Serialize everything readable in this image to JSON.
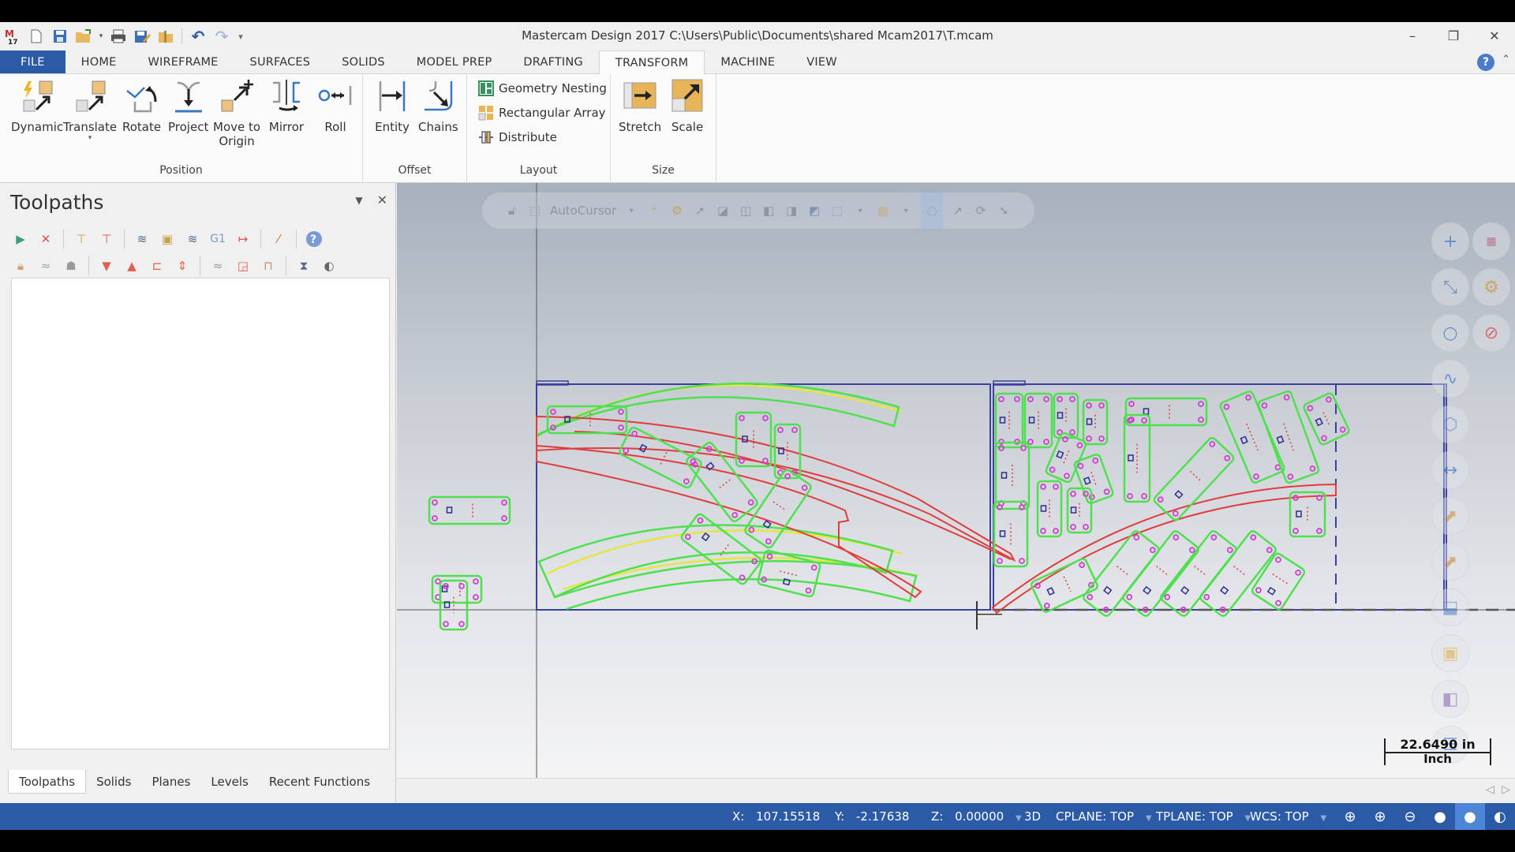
{
  "window": {
    "title": "Mastercam Design 2017  C:\\Users\\Public\\Documents\\shared Mcam2017\\T.mcam",
    "app_logo": "mastercam-17-logo",
    "minimize": "–",
    "restore": "❐",
    "close": "✕"
  },
  "quick_access": [
    {
      "name": "new-file-icon",
      "glyph": "🗋"
    },
    {
      "name": "save-icon",
      "glyph": "💾"
    },
    {
      "name": "open-folder-icon",
      "glyph": "📂"
    },
    {
      "name": "print-icon",
      "glyph": "🖶"
    },
    {
      "name": "save-as-icon",
      "glyph": "🖉"
    },
    {
      "name": "merge-icon",
      "glyph": "📁"
    },
    {
      "name": "undo-icon",
      "glyph": "↶"
    },
    {
      "name": "redo-icon",
      "glyph": "↷"
    },
    {
      "name": "customize-qat-icon",
      "glyph": "▾"
    }
  ],
  "tabs": [
    "FILE",
    "HOME",
    "WIREFRAME",
    "SURFACES",
    "SOLIDS",
    "MODEL PREP",
    "DRAFTING",
    "TRANSFORM",
    "MACHINE",
    "VIEW"
  ],
  "active_tab": "TRANSFORM",
  "ribbon": {
    "position": {
      "label": "Position",
      "buttons": [
        {
          "label": "Dynamic",
          "icon": "dynamic-transform-icon"
        },
        {
          "label": "Translate",
          "icon": "translate-icon",
          "has_dropdown": true
        },
        {
          "label": "Rotate",
          "icon": "rotate-icon"
        },
        {
          "label": "Project",
          "icon": "project-icon"
        },
        {
          "label": "Move to Origin",
          "line1": "Move to",
          "line2": "Origin",
          "icon": "move-to-origin-icon"
        },
        {
          "label": "Mirror",
          "icon": "mirror-icon"
        },
        {
          "label": "Roll",
          "icon": "roll-icon"
        }
      ]
    },
    "offset": {
      "label": "Offset",
      "buttons": [
        {
          "label": "Entity",
          "icon": "offset-entity-icon"
        },
        {
          "label": "Chains",
          "icon": "offset-chains-icon"
        }
      ]
    },
    "layout": {
      "label": "Layout",
      "buttons": [
        {
          "label": "Geometry Nesting",
          "icon": "geometry-nesting-icon"
        },
        {
          "label": "Rectangular Array",
          "icon": "rectangular-array-icon"
        },
        {
          "label": "Distribute",
          "icon": "distribute-icon"
        }
      ]
    },
    "size": {
      "label": "Size",
      "buttons": [
        {
          "label": "Stretch",
          "icon": "stretch-icon"
        },
        {
          "label": "Scale",
          "icon": "scale-icon"
        }
      ]
    }
  },
  "toolpaths_panel": {
    "title": "Toolpaths",
    "toolbar_row1": [
      "select-all-operations-icon",
      "deselect-all-icon",
      "regenerate-selected-icon",
      "regenerate-dirty-icon",
      "backplot-icon",
      "verify-icon",
      "simulate-icon",
      "post-selected-g1-icon",
      "high-feed-icon",
      "delete-operations-icon",
      "help-icon"
    ],
    "toolbar_row2": [
      "lock-icon",
      "toggle-display-icon",
      "toggle-posting-icon",
      "move-down-icon",
      "move-up-icon",
      "insert-arrow-icon",
      "scroll-icon",
      "only-display-selected-icon",
      "display-associated-geometry-icon",
      "display-tool-icon",
      "toolpath-manager-options-icon",
      "highlight-options-icon"
    ],
    "bottom_tabs": [
      "Toolpaths",
      "Solids",
      "Planes",
      "Levels",
      "Recent Functions"
    ],
    "active_bottom_tab": "Toolpaths"
  },
  "viewport": {
    "autocursor": {
      "label": "AutoCursor"
    },
    "scale_indicator": {
      "value": "22.6490 in",
      "unit": "Inch"
    },
    "right_toolbar": [
      "add-point-icon",
      "color-palette-icon",
      "analyze-distance-icon",
      "settings-gear-icon",
      "circle-icon",
      "clear-colors-icon",
      "spline-icon",
      "wireframe-cube-icon",
      "dimension-icon",
      "translate-view-icon",
      "rotate-view-icon",
      "layer-icon",
      "box-icon",
      "group-icon",
      "level-list-icon"
    ],
    "colors": {
      "sheet_border": "#3b3fa0",
      "part_outline": "#4fe04f",
      "red_part": "#e03c3c",
      "yellow_part": "#e6e640",
      "hole_points": "#d040d0",
      "origin_marks": "#2c2c90"
    }
  },
  "status_bar": {
    "x_label": "X:",
    "x_value": "107.15518",
    "y_label": "Y:",
    "y_value": "-2.17638",
    "z_label": "Z:",
    "z_value": "0.00000",
    "mode": "3D",
    "cplane": "CPLANE: TOP",
    "tplane": "TPLANE: TOP",
    "wcs": "WCS: TOP",
    "icons": [
      "wireframe-globe-icon",
      "hidden-lines-globe-icon",
      "hidden-lines-removed-icon",
      "shaded-icon",
      "shaded-with-edges-icon",
      "translucency-icon"
    ],
    "selected_icon": "shaded-with-edges-icon",
    "accent_color": "#2b5aa6"
  }
}
